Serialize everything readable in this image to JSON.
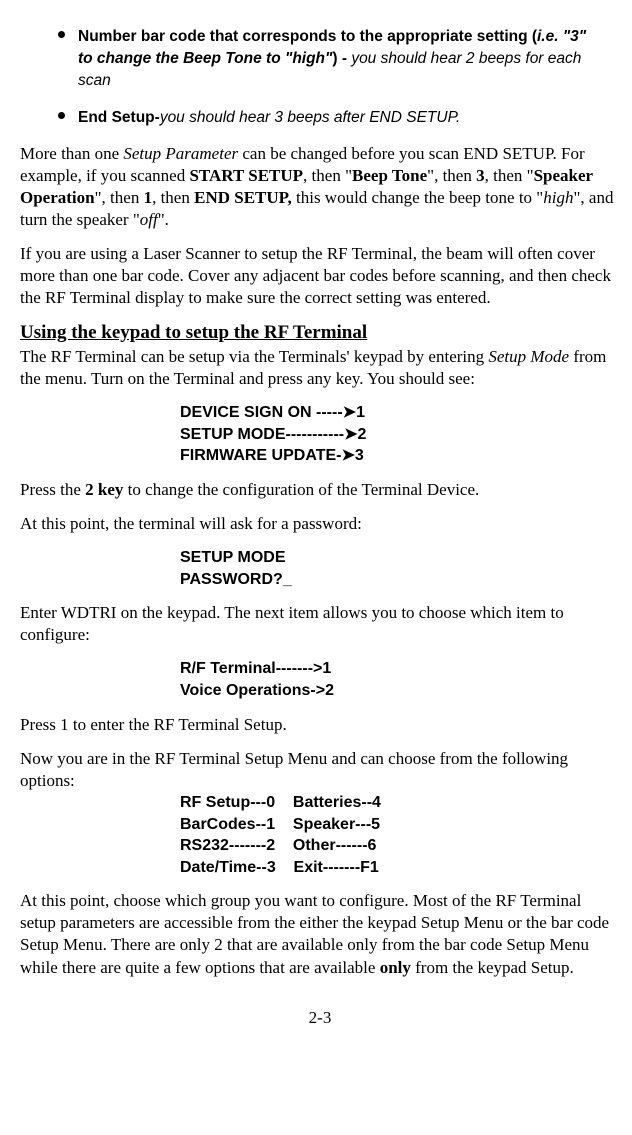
{
  "bullets": [
    {
      "bold": "Number bar code that corresponds to the appropriate setting",
      "italic_open": "(",
      "italic_body": "i.e. \"3\" to change the Beep Tone to \"high\"",
      "italic_close": ") - ",
      "italic_tail": "you should hear 2 beeps for each scan"
    },
    {
      "bold": "End Setup-",
      "italic": "you should hear 3 beeps after END SETUP."
    }
  ],
  "p1": {
    "a": "More than one ",
    "b": "Setup Parameter",
    "c": " can be changed before you scan END SETUP.  For example, if you scanned ",
    "d": "START SETUP",
    "e": ", then \"",
    "f": "Beep Tone",
    "g": "\", then ",
    "h": "3",
    "i": ", then  \"",
    "j": "Speaker Operation",
    "k": "\", then ",
    "l": "1",
    "m": ", then ",
    "n": "END SETUP,",
    "o": " this would change the beep tone to \"",
    "p": "high",
    "q": "\", and turn the speaker \"",
    "r": "off",
    "s": "\"."
  },
  "p2": "If you are using a Laser Scanner to setup the RF Terminal, the beam will often cover more than one bar code. Cover any adjacent bar codes before scanning, and then check the RF Terminal display to make sure the correct setting was entered.",
  "h1": "Using the keypad to setup the RF Terminal",
  "p3": {
    "a": "The RF Terminal can be setup via the Terminals' keypad by entering ",
    "b": "Setup Mode",
    "c": " from the menu. Turn on the Terminal and press any key. You should see:"
  },
  "menu1": {
    "l1": "DEVICE SIGN ON -----➤1",
    "l2": "SETUP MODE-----------➤2",
    "l3": "FIRMWARE UPDATE-➤3"
  },
  "p4": {
    "a": "Press the ",
    "b": "2 key",
    "c": " to change the configuration of the Terminal Device."
  },
  "p5": "At this point, the terminal will ask for a password:",
  "menu2": {
    "l1": "SETUP MODE",
    "l2": "PASSWORD?_"
  },
  "p6": "Enter WDTRI on the keypad.  The next item allows you to choose which item to configure:",
  "menu3": {
    "l1": "R/F Terminal------->1",
    "l2": "Voice Operations->2"
  },
  "p7": "Press 1 to enter the RF Terminal Setup.",
  "p8": " Now you are in the RF Terminal Setup Menu and can choose from the following options:",
  "menu4": {
    "l1": "RF Setup---0    Batteries--4",
    "l2": "BarCodes--1    Speaker---5",
    "l3": "RS232-------2    Other------6",
    "l4": "Date/Time--3    Exit-------F1"
  },
  "p9": {
    "a": "At this point, choose which group you want to configure. Most of the RF Terminal setup parameters are accessible from the either the keypad Setup Menu or the bar code Setup Menu. There are only 2 that are available only from the bar code Setup Menu while there are quite a few options that are available ",
    "b": "only",
    "c": " from the keypad Setup."
  },
  "page": "2-3"
}
